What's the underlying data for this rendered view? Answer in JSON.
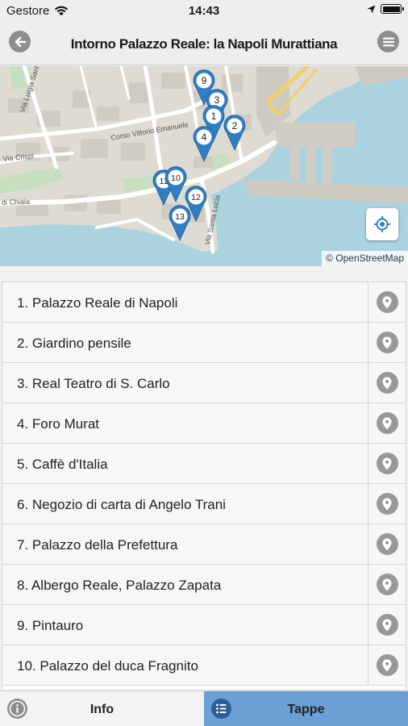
{
  "status_bar": {
    "carrier": "Gestore",
    "time": "14:43"
  },
  "header": {
    "title": "Intorno Palazzo Reale: la Napoli Murattiana",
    "back_icon": "back-arrow-icon",
    "menu_icon": "menu-icon"
  },
  "map": {
    "attribution": "© OpenStreetMap",
    "street_labels": [
      "Via Luigia Sanfelice",
      "Corso Vittorio Emanuele",
      "Via Crispi",
      "di Chiaia",
      "Via Santa Lucia"
    ],
    "markers": [
      "9",
      "3",
      "2",
      "1",
      "4",
      "11",
      "10",
      "12",
      "13"
    ],
    "marker_color": "#2f7fc4"
  },
  "stops": [
    "1. Palazzo Reale di Napoli",
    "2. Giardino pensile",
    "3. Real Teatro di S. Carlo",
    "4. Foro Murat",
    "5. Caffè d'Italia",
    "6. Negozio di carta di Angelo Trani",
    "7. Palazzo della Prefettura",
    "8. Albergo Reale, Palazzo Zapata",
    "9. Pintauro",
    "10. Palazzo del duca Fragnito"
  ],
  "tabs": {
    "info": "Info",
    "tappe": "Tappe",
    "active": "Tappe"
  },
  "colors": {
    "active_tab": "#6b9fd6",
    "pin_button": "#999999",
    "sea": "#aad3df"
  }
}
